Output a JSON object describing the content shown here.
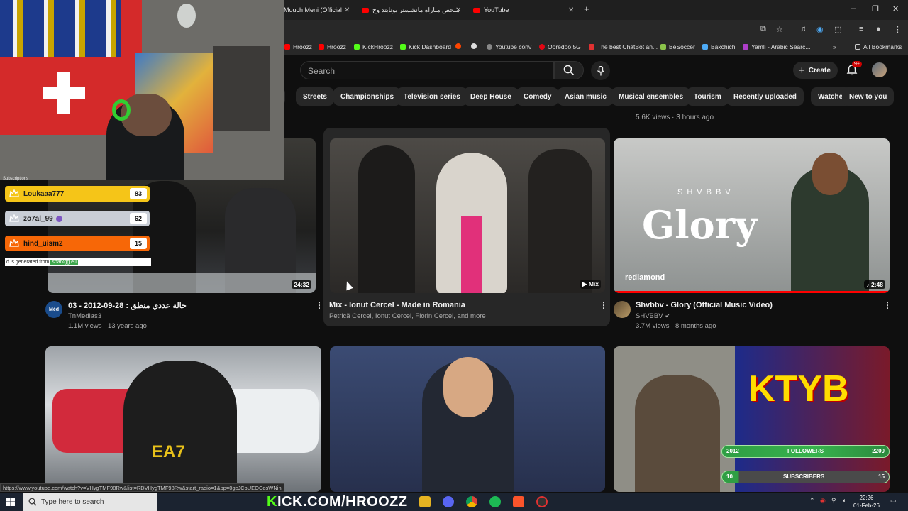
{
  "browser": {
    "tabs": [
      {
        "label": "Mouch Meni (Official"
      },
      {
        "label": "ملخص مباراة مانشستر يونايتد وح"
      },
      {
        "label": "YouTube"
      }
    ],
    "new_tab": "+",
    "window_controls": {
      "minimize": "–",
      "restore": "❐",
      "close": "✕"
    },
    "bookmarks": [
      {
        "label": "Hroozz",
        "color": "#ff0000"
      },
      {
        "label": "Hroozz",
        "color": "#ff0000"
      },
      {
        "label": "KickHroozz",
        "color": "#53fc18"
      },
      {
        "label": "Kick Dashboard",
        "color": "#53fc18"
      },
      {
        "label": "Youtube conv",
        "color": "#888888"
      },
      {
        "label": "Ooredoo 5G",
        "color": "#e30613"
      },
      {
        "label": "The best ChatBot an...",
        "color": "#e03131"
      },
      {
        "label": "BeSoccer",
        "color": "#8bc34a"
      },
      {
        "label": "Bakchich",
        "color": "#4dabf7"
      },
      {
        "label": "Yamli - Arabic Searc...",
        "color": "#ae3ec9"
      }
    ],
    "all_bookmarks": "All Bookmarks"
  },
  "youtube": {
    "search_placeholder": "Search",
    "create_label": "Create",
    "notif_badge": "9+",
    "chips": [
      "Streets",
      "Championships",
      "Television series",
      "Deep House",
      "Comedy",
      "Asian music",
      "Musical ensembles",
      "Tourism",
      "Recently uploaded",
      "Watched",
      "New to you"
    ],
    "prev_row_meta": "5.6K views · 3 hours ago",
    "videos": [
      {
        "title": "03 - 2012-09-28 : حالة عددي منطق",
        "channel": "TnMedias3",
        "meta": "1.1M views · 13 years ago",
        "duration": "24:32",
        "channel_badge": "Méd"
      },
      {
        "title": "Mix - Ionut Cercel - Made in Romania",
        "channel": "Petrică Cercel, Ionut Cercel, Florin Cercel, and more",
        "meta": "",
        "duration": "Mix"
      },
      {
        "title": "Shvbbv - Glory (Official Music Video)",
        "channel": "SHVBBV",
        "meta": "3.7M views · 8 months ago",
        "duration": "2:48",
        "thumb_text": "Glory",
        "thumb_sub": "SHVBBV",
        "thumb_brand": "redlamond"
      },
      {
        "title": "",
        "channel": "",
        "meta": "",
        "duration": "",
        "thumb_text": "EA7"
      },
      {
        "title": "",
        "channel": "",
        "meta": "",
        "duration": ""
      },
      {
        "title": "",
        "channel": "",
        "meta": "",
        "duration": "",
        "thumb_text": "KTYB"
      }
    ]
  },
  "stream_overlay": {
    "subs_title": "Subscriptions",
    "subs": [
      {
        "name": "Loukaaa777",
        "count": "83",
        "color": "#f5c518"
      },
      {
        "name": "zo7al_99",
        "count": "62",
        "color": "#c9ced6"
      },
      {
        "name": "hind_uism2",
        "count": "15",
        "color": "#f76707"
      }
    ],
    "generated_text": "d is generated from",
    "generated_source": "sparkgg.eu",
    "followers": {
      "count_left": "2012",
      "label": "FOLLOWERS",
      "goal": "2200"
    },
    "subscribers": {
      "count_left": "10",
      "label": "SUBSCRIBERS",
      "goal": "15"
    },
    "kick_prefix": "K",
    "kick_text": "ICK.COM/HROOZZ"
  },
  "status_url": "https://www.youtube.com/watch?v=VHygTMF98Rw&list=RDVHygTMF98Rw&start_radio=1&pp=0gcJCbUEOCosWNin",
  "taskbar": {
    "search_placeholder": "Type here to search",
    "time": "22:26",
    "date": "01-Feb-26"
  }
}
